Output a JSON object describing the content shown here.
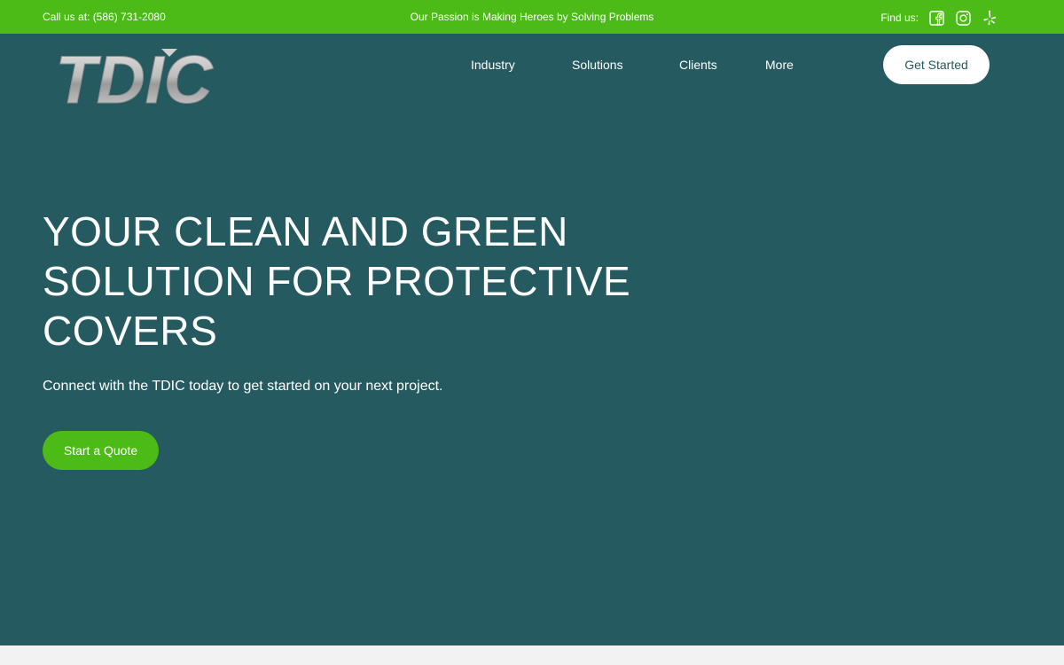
{
  "topbar": {
    "phone": "Call us at: (586) 731-2080",
    "tagline": "Our Passion is Making Heroes by Solving Problems",
    "find_label": "Find us:",
    "social_icons": [
      "facebook-icon",
      "instagram-icon",
      "yelp-icon"
    ]
  },
  "header": {
    "logo_text": "TDIC",
    "nav": [
      {
        "label": "Industry"
      },
      {
        "label": "Solutions"
      },
      {
        "label": "Clients"
      },
      {
        "label": "More"
      }
    ],
    "cta_label": "Get Started"
  },
  "hero": {
    "headline": "YOUR CLEAN AND GREEN SOLUTION FOR PROTECTIVE COVERS",
    "subheadline": "Connect with the TDIC today to get started on your next project.",
    "button_label": "Start a Quote"
  },
  "colors": {
    "brand_green": "#4cbb17",
    "hero_bg": "#245a60",
    "footer_strip": "#f2f2f2"
  }
}
